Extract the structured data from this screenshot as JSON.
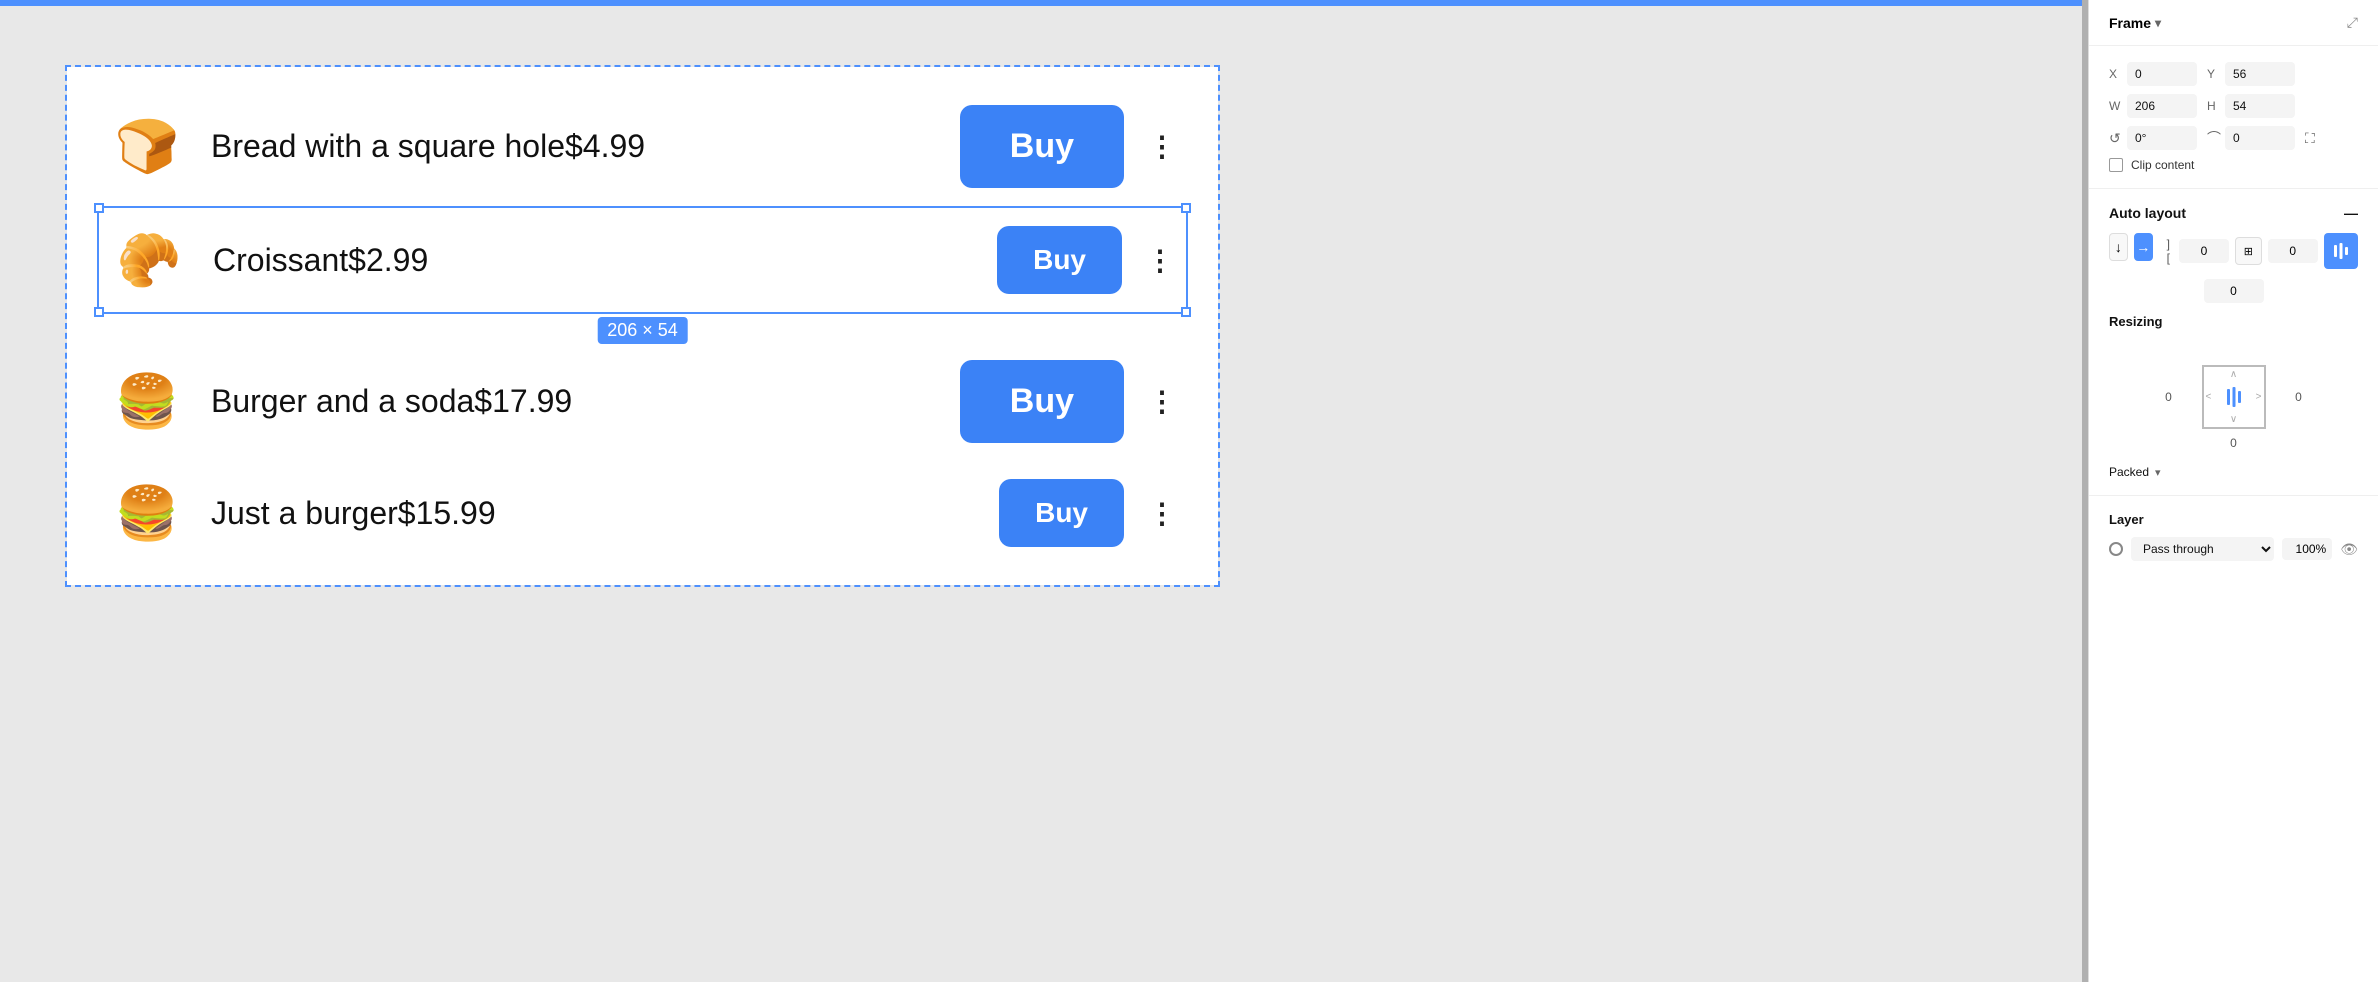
{
  "panel": {
    "frame_title": "Frame",
    "collapse_icon": "▾",
    "maximize_icon": "⤢",
    "x_label": "X",
    "x_value": "0",
    "y_label": "Y",
    "y_value": "56",
    "w_label": "W",
    "w_value": "206",
    "h_label": "H",
    "h_value": "54",
    "rotation_label": "0°",
    "corner_radius": "0",
    "clip_content_label": "Clip content",
    "auto_layout_title": "Auto layout",
    "minus_icon": "—",
    "spacing_h": "0",
    "spacing_v": "0",
    "spacing_center": "0",
    "padding_top": "0",
    "padding_right": "0",
    "padding_bottom": "0",
    "resizing_title": "Resizing",
    "resizing_left": "0",
    "resizing_right": "0",
    "resizing_top": "0",
    "packed_label": "Packed",
    "layer_title": "Layer",
    "pass_through_label": "Pass through",
    "opacity_value": "100%",
    "size_label": "206 × 54",
    "down_arrow": "↓",
    "right_arrow": "→"
  },
  "menu": {
    "items": [
      {
        "icon": "🍞",
        "name": "Bread with a square hole",
        "price": "$4.99",
        "buy_label": "Buy",
        "selected": false
      },
      {
        "icon": "🥐",
        "name": "Croissant",
        "price": "$2.99",
        "buy_label": "Buy",
        "selected": true
      },
      {
        "icon": "🍔",
        "name": "Burger and a soda",
        "price": "$17.99",
        "buy_label": "Buy",
        "selected": false
      },
      {
        "icon": "🍔",
        "name": "Just a burger",
        "price": "$15.99",
        "buy_label": "Buy",
        "selected": false
      }
    ]
  }
}
